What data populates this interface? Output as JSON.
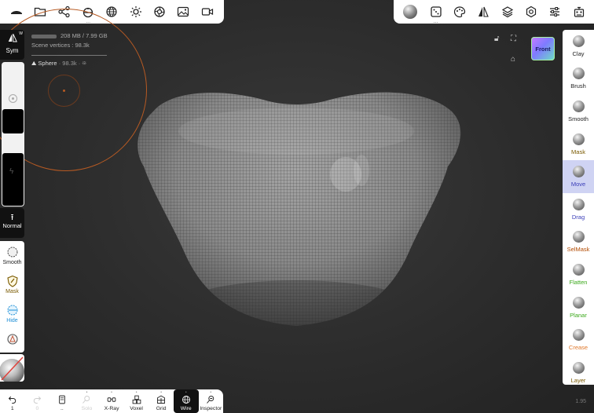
{
  "top_left_toolbar": [
    {
      "name": "scene-menu-icon"
    },
    {
      "name": "folder-icon"
    },
    {
      "name": "scene-graph-icon"
    },
    {
      "name": "history-icon"
    },
    {
      "name": "globe-icon"
    },
    {
      "name": "light-icon"
    },
    {
      "name": "render-icon"
    },
    {
      "name": "image-icon"
    },
    {
      "name": "camera-icon"
    }
  ],
  "top_right_toolbar": [
    {
      "name": "sculpt-tool-icon"
    },
    {
      "name": "dice-icon"
    },
    {
      "name": "palette-icon"
    },
    {
      "name": "symmetry-icon"
    },
    {
      "name": "layers-icon"
    },
    {
      "name": "settings-icon"
    },
    {
      "name": "sliders-icon"
    },
    {
      "name": "robot-icon"
    }
  ],
  "info": {
    "memory": "208 MB / 7.99 GB",
    "scene_vertices": "Scene vertices : 98.3k",
    "object_name": "Sphere",
    "object_detail": "· 98.3k · ⛯"
  },
  "left_panel": {
    "sym_label": "Sym",
    "sym_superscript": "W",
    "normal_label": "Normal",
    "tools": [
      {
        "label": "Smooth",
        "color": "#222222"
      },
      {
        "label": "Mask",
        "color": "#7a5a00"
      },
      {
        "label": "Hide",
        "color": "#1e8fd6"
      }
    ]
  },
  "viewport": {
    "front_label": "Front",
    "version": "1.95"
  },
  "right_tools": [
    {
      "label": "Clay",
      "color": "#222222",
      "active": false
    },
    {
      "label": "Brush",
      "color": "#222222",
      "active": false
    },
    {
      "label": "Smooth",
      "color": "#222222",
      "active": false
    },
    {
      "label": "Mask",
      "color": "#7a5a00",
      "active": false
    },
    {
      "label": "Move",
      "color": "#3a3db8",
      "active": true
    },
    {
      "label": "Drag",
      "color": "#3a3db8",
      "active": false
    },
    {
      "label": "SelMask",
      "color": "#b24a00",
      "active": false
    },
    {
      "label": "Flatten",
      "color": "#3aa81a",
      "active": false
    },
    {
      "label": "Planar",
      "color": "#3aa81a",
      "active": false
    },
    {
      "label": "Crease",
      "color": "#e0782a",
      "active": false
    },
    {
      "label": "Layer",
      "color": "#7a5a00",
      "active": false
    }
  ],
  "bottom_toolbar": [
    {
      "label": "1",
      "name": "undo-button",
      "disabled": false,
      "active": false
    },
    {
      "label": "0",
      "name": "redo-button",
      "disabled": true,
      "active": false
    },
    {
      "label": "..",
      "name": "tool-stack-button",
      "disabled": false,
      "active": false
    },
    {
      "label": "Solo",
      "name": "solo-button",
      "disabled": true,
      "active": false
    },
    {
      "label": "X-Ray",
      "name": "xray-button",
      "disabled": false,
      "active": false
    },
    {
      "label": "Voxel",
      "name": "voxel-button",
      "disabled": false,
      "active": false
    },
    {
      "label": "Grid",
      "name": "grid-button",
      "disabled": false,
      "active": false
    },
    {
      "label": "Wire",
      "name": "wire-button",
      "disabled": false,
      "active": true
    },
    {
      "label": "Inspector",
      "name": "inspector-button",
      "disabled": false,
      "active": false
    }
  ]
}
